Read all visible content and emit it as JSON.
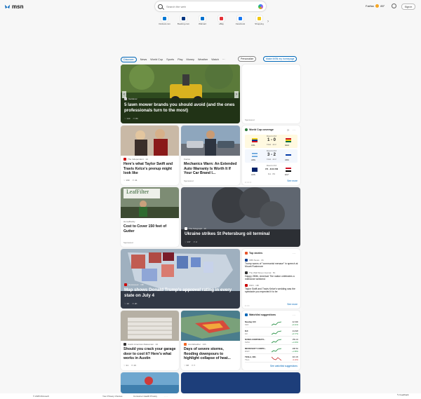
{
  "header": {
    "logo": "msn",
    "search_placeholder": "Search the web",
    "location": "Fairfax",
    "temp": "85°",
    "signin": "Sign in"
  },
  "quicklinks": [
    {
      "label": "Outlook.com",
      "color": "#0078d4"
    },
    {
      "label": "Booking.com",
      "color": "#003580"
    },
    {
      "label": "Walmart",
      "color": "#0071ce"
    },
    {
      "label": "eBay",
      "color": "#e53238"
    },
    {
      "label": "Facebook",
      "color": "#1877f2"
    },
    {
      "label": "Shopping",
      "color": "#f2c811"
    }
  ],
  "nav": {
    "tabs": [
      "Discover",
      "News",
      "World Cup",
      "Sports",
      "Play",
      "Money",
      "Weather",
      "Watch",
      "···"
    ],
    "personalize": "Personalize",
    "homepage": "Make MSN my homepage"
  },
  "hero": {
    "source": "Gardener",
    "title": "5 lawn mower brands you should avoid (and the ones professionals turn to the most)",
    "likes": "144",
    "comments": "84"
  },
  "sponsored_label": "Sponsored",
  "card1": {
    "source": "The Independent · 1d",
    "title": "Here's what Taylor Swift and Travis Kelce's prenup might look like",
    "likes": "190",
    "comments": "41"
  },
  "card2": {
    "source": "Fonlox",
    "title": "Mechanics Warn: An Extended Auto Warranty Is Worth It If Your Car Brand I...",
    "sponsored": "Sponsored"
  },
  "worldcup": {
    "title": "World Cup coverage",
    "matches": [
      {
        "stage": "Round of 16",
        "home": "COL",
        "away": "GHA",
        "score": "1 - 0",
        "status": "Final · Jul 2",
        "home_colors": [
          "#fcd116",
          "#003893",
          "#ce1126"
        ],
        "away_colors": [
          "#ce1126",
          "#fcd116",
          "#006b3f"
        ]
      },
      {
        "stage": "Round of 16",
        "home": "ARG",
        "away": "URU",
        "score": "3 - 2",
        "status": "Final · Jul 2",
        "home_colors": [
          "#74acdf",
          "#ffffff",
          "#74acdf"
        ],
        "away_colors": [
          "#ffffff",
          "#0038a8",
          "#ffffff"
        ]
      },
      {
        "stage": "Round of 16",
        "home": "AUS",
        "away": "EGY",
        "score": "7/5 · 8:00 PM",
        "status": "Fox · 8/1",
        "home_colors": [
          "#012169",
          "#012169",
          "#012169"
        ],
        "away_colors": [
          "#ce1126",
          "#ffffff",
          "#000000"
        ]
      }
    ],
    "see_more": "See more"
  },
  "card3": {
    "source": "HomeBuddy",
    "title": "Cost to Cover 150 feet of Gutter",
    "sponsored": "Sponsored",
    "sign": "LeafFilter"
  },
  "card4": {
    "source": "The Telegraph · 2h",
    "title": "Ukraine strikes St Petersburg oil terminal",
    "likes": "137",
    "comments": "2"
  },
  "card5": {
    "source": "Newsweek · 18h",
    "title": "Map shows Donald Trump's approval rating in every state on July 4",
    "likes": "1K",
    "comments": "2K"
  },
  "topstories": {
    "title": "Top stories",
    "items": [
      {
        "source": "CBS News · 3h",
        "text": "Trump warns of \"communist menace\" in speech at Mount Rushmore"
      },
      {
        "source": "The Wall Street Journal · 5h",
        "text": "Happy 250th, America! The nation celebrates a milestone weekend"
      },
      {
        "source": "CNN · 10h",
        "text": "Taylor Swift and Travis Kelce's wedding was the spectacle you expected it to be"
      }
    ],
    "see_more": "See more"
  },
  "card6": {
    "source": "Austin American-Statesman · 4d",
    "title": "Should you crack your garage door to cool it? Here's what works in Austin",
    "likes": "41",
    "comments": "16"
  },
  "card7": {
    "source": "AccuWeather · 14h",
    "title": "Days of severe storms, flooding downpours to highlight collapse of heat...",
    "likes": "68",
    "comments": "7"
  },
  "watchlist": {
    "title": "Watchlist suggestions",
    "rows": [
      {
        "name": "Nasdaq 100",
        "sub": "NDX",
        "price": "22,900",
        "change": "+0.21%",
        "up": true
      },
      {
        "name": "DJI",
        "sub": "DJI",
        "price": "44,828",
        "change": "+0.77%",
        "up": true
      },
      {
        "name": "NVIDIA CORPORATI...",
        "sub": "NVDA",
        "price": "159.34",
        "change": "+1.33%",
        "up": true
      },
      {
        "name": "MICROSOFT CORPO...",
        "sub": "MSFT",
        "price": "498.84",
        "change": "+1.58%",
        "up": true
      },
      {
        "name": "TESLA, INC.",
        "sub": "TSLA",
        "price": "315.35",
        "change": "-0.10%",
        "up": false
      }
    ],
    "see_more": "See watchlist suggestions"
  },
  "footer": {
    "copyright": "© 2025 Microsoft",
    "privacy": "Your Privacy Choices",
    "consumer": "Consumer Health Privacy",
    "more": "· · ·",
    "feedback": "Feedback"
  }
}
